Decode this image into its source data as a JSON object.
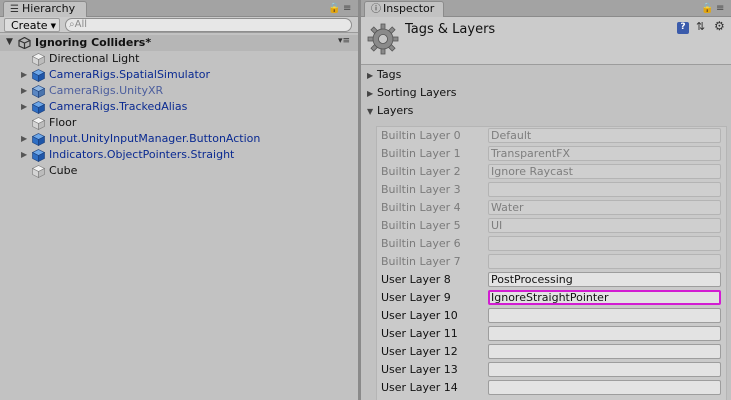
{
  "hierarchy": {
    "tab_label": "Hierarchy",
    "tab_icon": "list-icon",
    "create_label": "Create",
    "search_placeholder": "All",
    "scene": {
      "title": "Ignoring Colliders*"
    },
    "items": [
      {
        "label": "Directional Light",
        "style": "plain",
        "has_children": false
      },
      {
        "label": "CameraRigs.SpatialSimulator",
        "style": "blue",
        "has_children": true
      },
      {
        "label": "CameraRigs.UnityXR",
        "style": "blue-dim",
        "has_children": true
      },
      {
        "label": "CameraRigs.TrackedAlias",
        "style": "blue",
        "has_children": true
      },
      {
        "label": "Floor",
        "style": "plain",
        "has_children": false
      },
      {
        "label": "Input.UnityInputManager.ButtonAction",
        "style": "blue",
        "has_children": true
      },
      {
        "label": "Indicators.ObjectPointers.Straight",
        "style": "blue",
        "has_children": true
      },
      {
        "label": "Cube",
        "style": "plain",
        "has_children": false
      }
    ]
  },
  "inspector": {
    "tab_label": "Inspector",
    "tab_icon": "info-icon",
    "title": "Tags & Layers",
    "help_glyph": "?",
    "sections": [
      {
        "label": "Tags",
        "expanded": false
      },
      {
        "label": "Sorting Layers",
        "expanded": false
      },
      {
        "label": "Layers",
        "expanded": true
      }
    ],
    "layers": [
      {
        "name": "Builtin Layer 0",
        "value": "Default",
        "kind": "builtin"
      },
      {
        "name": "Builtin Layer 1",
        "value": "TransparentFX",
        "kind": "builtin"
      },
      {
        "name": "Builtin Layer 2",
        "value": "Ignore Raycast",
        "kind": "builtin"
      },
      {
        "name": "Builtin Layer 3",
        "value": "",
        "kind": "builtin"
      },
      {
        "name": "Builtin Layer 4",
        "value": "Water",
        "kind": "builtin"
      },
      {
        "name": "Builtin Layer 5",
        "value": "UI",
        "kind": "builtin"
      },
      {
        "name": "Builtin Layer 6",
        "value": "",
        "kind": "builtin"
      },
      {
        "name": "Builtin Layer 7",
        "value": "",
        "kind": "builtin"
      },
      {
        "name": "User Layer 8",
        "value": "PostProcessing",
        "kind": "user"
      },
      {
        "name": "User Layer 9",
        "value": "IgnoreStraightPointer",
        "kind": "user",
        "highlighted": true
      },
      {
        "name": "User Layer 10",
        "value": "",
        "kind": "user"
      },
      {
        "name": "User Layer 11",
        "value": "",
        "kind": "user"
      },
      {
        "name": "User Layer 12",
        "value": "",
        "kind": "user"
      },
      {
        "name": "User Layer 13",
        "value": "",
        "kind": "user"
      },
      {
        "name": "User Layer 14",
        "value": "",
        "kind": "user"
      }
    ]
  },
  "colors": {
    "prefab_blue": "#0a2a91",
    "highlight": "#d21cd2",
    "panel_bg": "#c2c2c2"
  }
}
